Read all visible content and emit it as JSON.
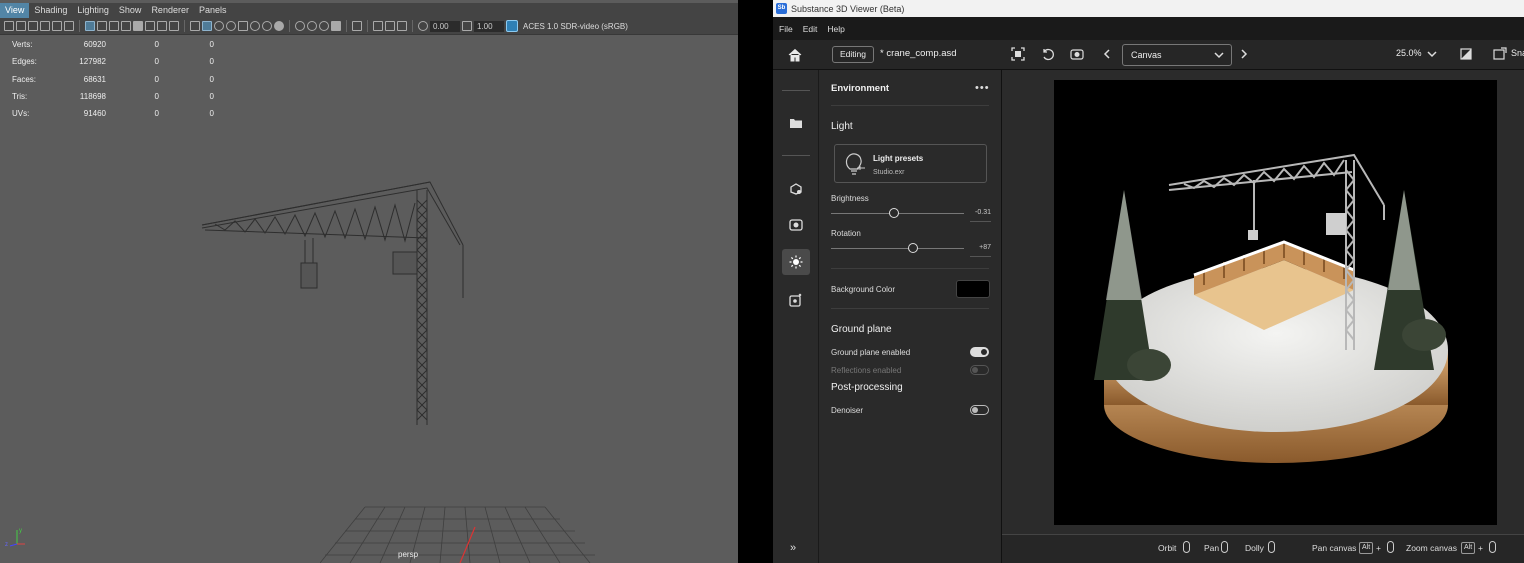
{
  "maya": {
    "menu": [
      "View",
      "Shading",
      "Lighting",
      "Show",
      "Renderer",
      "Panels"
    ],
    "toolbar": {
      "exposure": "0.00",
      "gamma": "1.00",
      "color_transform": "ACES 1.0 SDR-video (sRGB)"
    },
    "stats": [
      {
        "label": "Verts:",
        "value": "60920",
        "sel": "0",
        "comp": "0"
      },
      {
        "label": "Edges:",
        "value": "127982",
        "sel": "0",
        "comp": "0"
      },
      {
        "label": "Faces:",
        "value": "68631",
        "sel": "0",
        "comp": "0"
      },
      {
        "label": "Tris:",
        "value": "118698",
        "sel": "0",
        "comp": "0"
      },
      {
        "label": "UVs:",
        "value": "91460",
        "sel": "0",
        "comp": "0"
      }
    ],
    "camera_label": "persp",
    "axis": {
      "x": "x",
      "y": "y",
      "z": "z"
    }
  },
  "viewer": {
    "title": "Substance 3D Viewer (Beta)",
    "logo": "Sb",
    "menu": [
      "File",
      "Edit",
      "Help"
    ],
    "header": {
      "mode": "Editing",
      "file": "* crane_comp.asd",
      "canvas": "Canvas",
      "zoom": "25.0%",
      "snap": "Sna"
    },
    "panel": {
      "title": "Environment",
      "light_section": "Light",
      "preset_title": "Light presets",
      "preset_file": "Studio.exr",
      "brightness_label": "Brightness",
      "brightness_value": "-0.31",
      "brightness_fraction": 0.47,
      "rotation_label": "Rotation",
      "rotation_value": "+87",
      "rotation_fraction": 0.62,
      "bg_color_label": "Background Color",
      "bg_color": "#000000",
      "ground_section": "Ground plane",
      "ground_enabled_label": "Ground plane enabled",
      "ground_enabled": true,
      "reflections_label": "Reflections enabled",
      "reflections_enabled": false,
      "post_section": "Post-processing",
      "denoiser_label": "Denoiser",
      "denoiser_enabled": false
    },
    "footer": {
      "orbit": "Orbit",
      "pan": "Pan",
      "dolly": "Dolly",
      "pan_canvas": "Pan canvas",
      "zoom_canvas": "Zoom canvas",
      "alt_key": "Alt",
      "plus": "+"
    },
    "expand": "»"
  }
}
